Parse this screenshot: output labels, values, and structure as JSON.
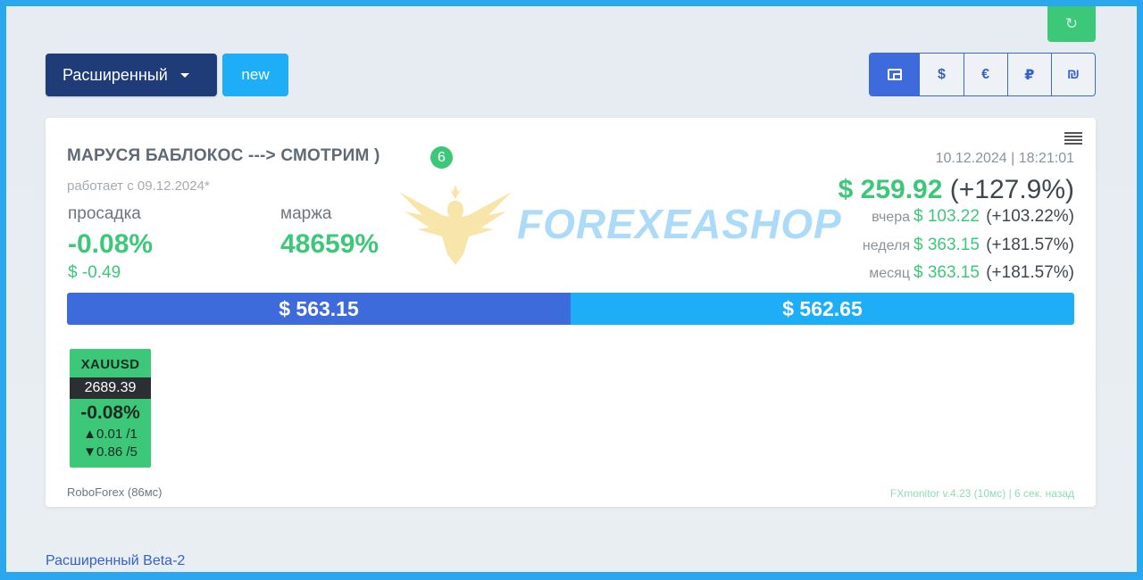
{
  "toolbar": {
    "refresh_icon": "refresh-icon",
    "mode_label": "Расширенный",
    "new_label": "new",
    "currencies": [
      "wallet",
      "$",
      "€",
      "₽",
      "₪"
    ]
  },
  "account": {
    "title": "МАРУСЯ БАБЛОКОС ---> СМОТРИМ )",
    "count": "6",
    "datetime": "10.12.2024 | 18:21:01",
    "since": "работает с 09.12.2024*",
    "drawdown_label": "просадка",
    "drawdown_pct": "-0.08%",
    "drawdown_usd": "$ -0.49",
    "margin_label": "маржа",
    "margin_pct": "48659%",
    "profit_value": "$ 259.92",
    "profit_pct": "(+127.9%)",
    "yesterday_label": "вчера",
    "yesterday_value": "$ 103.22",
    "yesterday_pct": "(+103.22%)",
    "week_label": "неделя",
    "week_value": "$ 363.15",
    "week_pct": "(+181.57%)",
    "month_label": "месяц",
    "month_value": "$ 363.15",
    "month_pct": "(+181.57%)",
    "balance": "$ 563.15",
    "equity": "$ 562.65",
    "broker": "RoboForex (86мс)",
    "version": "FXmonitor v.4.23 (10мс) | 6 сек. назад"
  },
  "symbol": {
    "name": "XAUUSD",
    "price": "2689.39",
    "pct": "-0.08%",
    "buy_line": "▲0.01 /1",
    "sell_line": "▼0.86 /5"
  },
  "footer": {
    "label": "Расширенный Beta-2"
  },
  "watermark": {
    "text": "FOREXEASHOP"
  },
  "colors": {
    "accent_blue": "#3e6bdb",
    "light_blue": "#1eaef8",
    "green": "#3cc878",
    "navy": "#1f3b78"
  }
}
